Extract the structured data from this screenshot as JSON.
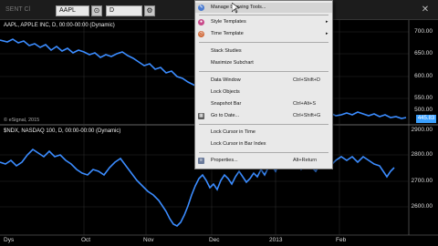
{
  "toolbar": {
    "title": "SENT Cl",
    "symbol": "AAPL",
    "interval": "D"
  },
  "top_pane": {
    "label": "AAPL, APPLE INC, D, 00:00-00:00 (Dynamic)",
    "copyright": "© eSignal, 2015",
    "last_price": "445.83",
    "y_axis": [
      "700.00",
      "650.00",
      "600.00",
      "550.00",
      "500.00"
    ]
  },
  "bottom_pane": {
    "label": "$NDX, NASDAQ 100, D, 00:00-00:00 (Dynamic)",
    "y_axis": [
      "2900.00",
      "2800.00",
      "2700.00",
      "2600.00"
    ]
  },
  "x_axis": {
    "labels": [
      "Dys",
      "Oct",
      "Nov",
      "Dec",
      "2013",
      "Feb"
    ]
  },
  "context_menu": {
    "items": [
      {
        "label": "Manage Drawing Tools...",
        "icon": "pencil-icon"
      },
      {
        "label": "Style Templates",
        "icon": "palette-icon",
        "submenu": "▸"
      },
      {
        "label": "Time Template",
        "icon": "clock-icon",
        "submenu": "▸"
      },
      {
        "label": "Stack Studies"
      },
      {
        "label": "Maximize Subchart"
      },
      {
        "label": "Data Window",
        "shortcut": "Ctrl+Shift+D"
      },
      {
        "label": "Lock Objects"
      },
      {
        "label": "Snapshot Bar",
        "shortcut": "Ctrl+Alt+S"
      },
      {
        "label": "Go to Date...",
        "icon": "calendar-icon",
        "shortcut": "Ctrl+Shift+G"
      },
      {
        "label": "Lock Cursor in Time"
      },
      {
        "label": "Lock Cursor in Bar Index"
      },
      {
        "label": "Properties...",
        "icon": "properties-icon",
        "shortcut": "Alt+Return"
      }
    ]
  },
  "colors": {
    "line": "#3b8cff",
    "background": "#000000",
    "grid": "#333333",
    "badge": "#3aa0ff"
  }
}
